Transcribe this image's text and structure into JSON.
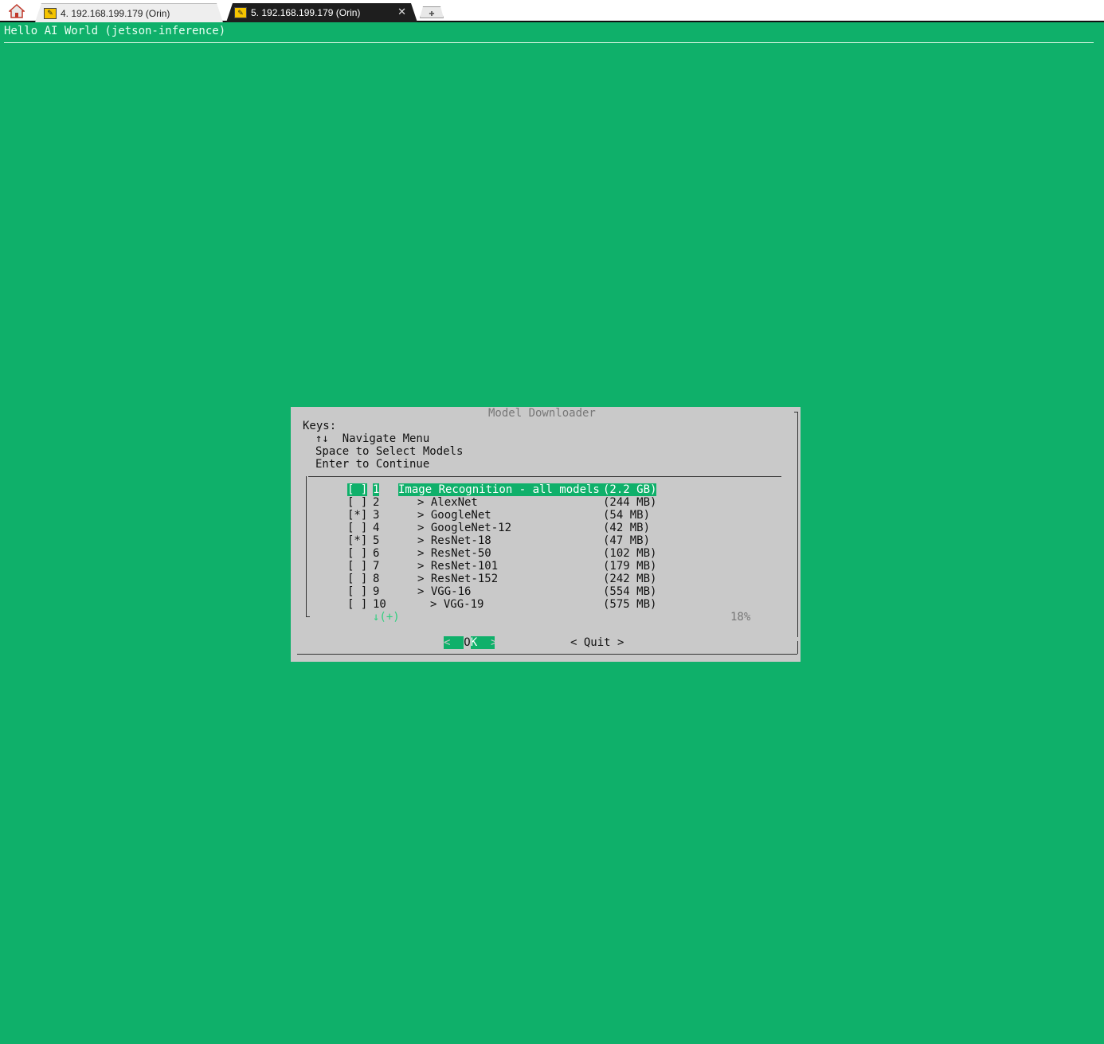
{
  "tabs": {
    "inactive": {
      "label": "4. 192.168.199.179 (Orin)"
    },
    "active": {
      "label": "5. 192.168.199.179 (Orin)"
    }
  },
  "terminal": {
    "backtitle": "Hello AI World (jetson-inference)"
  },
  "dialog": {
    "title": "Model Downloader",
    "keys_heading": "Keys:",
    "keys": [
      "↑↓  Navigate Menu",
      "Space to Select Models",
      "Enter to Continue"
    ],
    "items": [
      {
        "check": "[ ]",
        "num": "1",
        "name": "Image Recognition - all models",
        "size": "(2.2 GB)",
        "selected": true
      },
      {
        "check": "[ ]",
        "num": "2",
        "name": "> AlexNet",
        "size": "(244 MB)"
      },
      {
        "check": "[*]",
        "num": "3",
        "name": "> GoogleNet",
        "size": "(54 MB)"
      },
      {
        "check": "[ ]",
        "num": "4",
        "name": "> GoogleNet-12",
        "size": "(42 MB)"
      },
      {
        "check": "[*]",
        "num": "5",
        "name": "> ResNet-18",
        "size": "(47 MB)"
      },
      {
        "check": "[ ]",
        "num": "6",
        "name": "> ResNet-50",
        "size": "(102 MB)"
      },
      {
        "check": "[ ]",
        "num": "7",
        "name": "> ResNet-101",
        "size": "(179 MB)"
      },
      {
        "check": "[ ]",
        "num": "8",
        "name": "> ResNet-152",
        "size": "(242 MB)"
      },
      {
        "check": "[ ]",
        "num": "9",
        "name": "> VGG-16",
        "size": "(554 MB)"
      },
      {
        "check": "[ ]",
        "num": "10",
        "name": "> VGG-19",
        "size": "(575 MB)"
      }
    ],
    "scroll_hint": "↓(+)",
    "scroll_percent": "18%",
    "ok_button": {
      "left": "<",
      "label_first": "O",
      "label_rest": "K",
      "right": ">"
    },
    "quit_button": "< Quit >"
  },
  "colors": {
    "terminal_background": "#0fb06a",
    "dialog_background": "#c9c9c9",
    "highlight": "#0fb06a"
  }
}
